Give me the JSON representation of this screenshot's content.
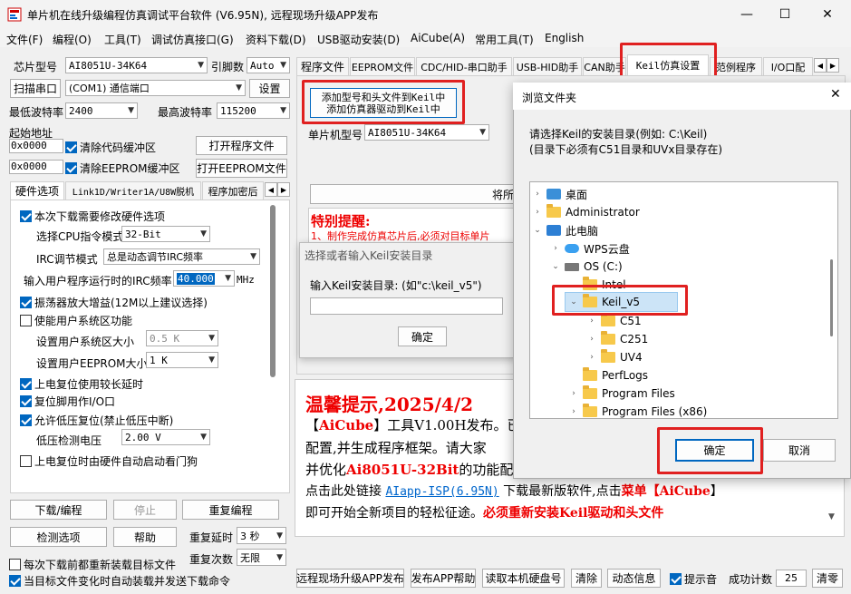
{
  "window": {
    "title": "单片机在线升级编程仿真调试平台软件 (V6.95N), 远程现场升级APP发布",
    "min": "—",
    "max": "☐",
    "close": "✕"
  },
  "menu": [
    "文件(F)",
    "编程(O)",
    "工具(T)",
    "调试仿真接口(G)",
    "资料下载(D)",
    "USB驱动安装(D)",
    "AiCube(A)",
    "常用工具(T)",
    "English"
  ],
  "left": {
    "chip_label": "芯片型号",
    "chip_value": "AI8051U-34K64",
    "pin_label": "引脚数",
    "pin_value": "Auto",
    "scan_btn": "扫描串口",
    "port_value": "(COM1) 通信端口",
    "settings_btn": "设置",
    "min_baud_label": "最低波特率",
    "min_baud_value": "2400",
    "max_baud_label": "最高波特率",
    "max_baud_value": "115200",
    "start_addr_label": "起始地址",
    "addr1": "0x0000",
    "clear_code": "清除代码缓冲区",
    "open_program": "打开程序文件",
    "addr2": "0x0000",
    "clear_eeprom": "清除EEPROM缓冲区",
    "open_eeprom": "打开EEPROM文件",
    "tabs": [
      "硬件选项",
      "Link1D/Writer1A/U8W脱机",
      "程序加密后"
    ],
    "hw": {
      "modify_hw": "本次下载需要修改硬件选项",
      "cpu_mode_label": "选择CPU指令模式",
      "cpu_mode_value": "32-Bit",
      "irc_mode_label": "IRC调节模式",
      "irc_mode_value": "总是动态调节IRC频率",
      "irc_freq_label": "输入用户程序运行时的IRC频率",
      "irc_freq_value": "40.000",
      "mhz": "MHz",
      "osc_gain": "振荡器放大增益(12M以上建议选择)",
      "user_sys_area": "使能用户系统区功能",
      "user_sys_size_label": "设置用户系统区大小",
      "user_sys_size_value": "0.5 K",
      "user_eeprom_label": "设置用户EEPROM大小",
      "user_eeprom_value": "1   K",
      "long_delay": "上电复位使用较长延时",
      "reset_io": "复位脚用作I/O口",
      "low_volt_reset": "允许低压复位(禁止低压中断)",
      "low_volt_label": "低压检测电压",
      "low_volt_value": "2.00 V",
      "watchdog": "上电复位时由硬件自动启动看门狗"
    },
    "download_btn": "下载/编程",
    "stop_btn": "停止",
    "reprogram_btn": "重复编程",
    "detect_btn": "检测选项",
    "help_btn": "帮助",
    "repeat_delay_label": "重复延时",
    "repeat_delay_value": "3 秒",
    "repeat_count_label": "重复次数",
    "repeat_count_value": "无限",
    "reload_each": "每次下载前都重新装载目标文件",
    "auto_reload": "当目标文件变化时自动装载并发送下载命令"
  },
  "right": {
    "tabs": [
      "程序文件",
      "EEPROM文件",
      "CDC/HID-串口助手",
      "USB-HID助手",
      "CAN助手",
      "Keil仿真设置",
      "范例程序",
      "I/O口配"
    ],
    "add_btn_line1": "添加型号和头文件到Keil中",
    "add_btn_line2": "添加仿真器驱动到Keil中",
    "chip_label": "单片机型号",
    "chip_value": "AI8051U-34K64",
    "convert_btn": "将所",
    "notice_title": "特别提醒:",
    "notice_text": "1、制作完成仿真芯片后,必须对目标单片",
    "tip_title": "温馨提示,2025/4/2",
    "tip_l1_a": "【",
    "tip_l1_b": "AiCube",
    "tip_l1_c": "】工具V1.00H发布。已",
    "tip_l2": "配置,并生成程序框架。请大家",
    "tip_l3_a": "并优化",
    "tip_l3_b": "Ai8051U-32Bit",
    "tip_l3_c": "的功能配",
    "tip_l4_a": "点击此处链接 ",
    "tip_l4_link": "AIapp-ISP(6.95N)",
    "tip_l4_b": " 下载最新版软件,点击",
    "tip_l4_c": "菜单【AiCube",
    "tip_l4_d": "】",
    "tip_l5_a": "即可开始全新项目的轻松征途。",
    "tip_l5_b": "必须重新安装Keil驱动和头文件",
    "bottom_btns": [
      "远程现场升级APP发布",
      "发布APP帮助",
      "读取本机硬盘号",
      "清除",
      "动态信息"
    ],
    "beep": "提示音",
    "success_label": "成功计数",
    "success_value": "25",
    "clear_btn": "清零"
  },
  "keil_dialog": {
    "title": "选择或者输入Keil安装目录",
    "prompt": "输入Keil安装目录: (如\"c:\\keil_v5\")",
    "ok": "确定"
  },
  "browse": {
    "title": "浏览文件夹",
    "line1": "请选择Keil的安装目录(例如: C:\\Keil)",
    "line2": "(目录下必须有C51目录和UVx目录存在)",
    "tree": [
      "桌面",
      "Administrator",
      "此电脑",
      "WPS云盘",
      "OS (C:)",
      "Intel",
      "Keil_v5",
      "C51",
      "C251",
      "UV4",
      "PerfLogs",
      "Program Files",
      "Program Files (x86)"
    ],
    "ok": "确定",
    "cancel": "取消",
    "close": "✕"
  }
}
